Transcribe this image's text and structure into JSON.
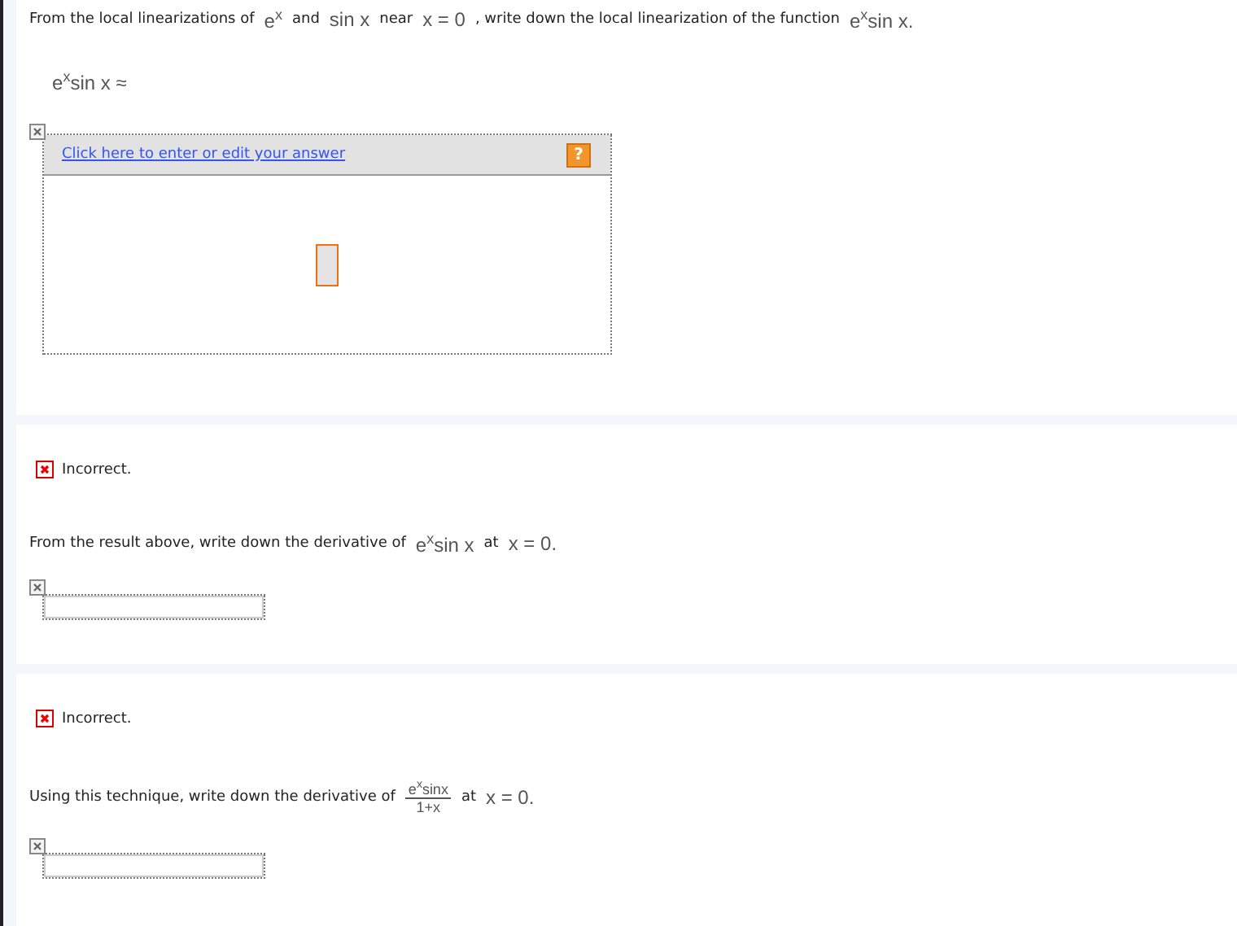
{
  "questions": [
    {
      "prompt": [
        {
          "kind": "text",
          "text": "From the local linearizations of"
        },
        {
          "kind": "math",
          "text": "e$^{x}$"
        },
        {
          "kind": "text",
          "text": "and"
        },
        {
          "kind": "math",
          "text": "sin x"
        },
        {
          "kind": "text",
          "text": "near"
        },
        {
          "kind": "math",
          "text": "x = 0"
        },
        {
          "kind": "text",
          "text": ", write down the local linearization of the function"
        },
        {
          "kind": "math",
          "text": "e$^{x}$sin x."
        }
      ],
      "lhs": "e$^{x}$sin x ≈",
      "answer": {
        "kind": "editor",
        "link": "Click here to enter or edit your answer",
        "help": "?"
      }
    },
    {
      "feedback": {
        "text": "Incorrect.",
        "correct": false
      },
      "prompt": [
        {
          "kind": "text",
          "text": "From the result above, write down the derivative of"
        },
        {
          "kind": "math",
          "text": "e$^{x}$sin x"
        },
        {
          "kind": "text",
          "text": "at"
        },
        {
          "kind": "math",
          "text": "x = 0."
        }
      ],
      "answer": {
        "kind": "field"
      }
    },
    {
      "feedback": {
        "text": "Incorrect.",
        "correct": false
      },
      "prompt": [
        {
          "kind": "text",
          "text": "Using this technique, write down the derivative of"
        },
        {
          "kind": "fraction",
          "numerator": "e$^{x}$sinx",
          "denominator": "1+x"
        },
        {
          "kind": "text",
          "text": "at"
        },
        {
          "kind": "math",
          "text": "x = 0."
        }
      ],
      "answer": {
        "kind": "field"
      }
    }
  ]
}
